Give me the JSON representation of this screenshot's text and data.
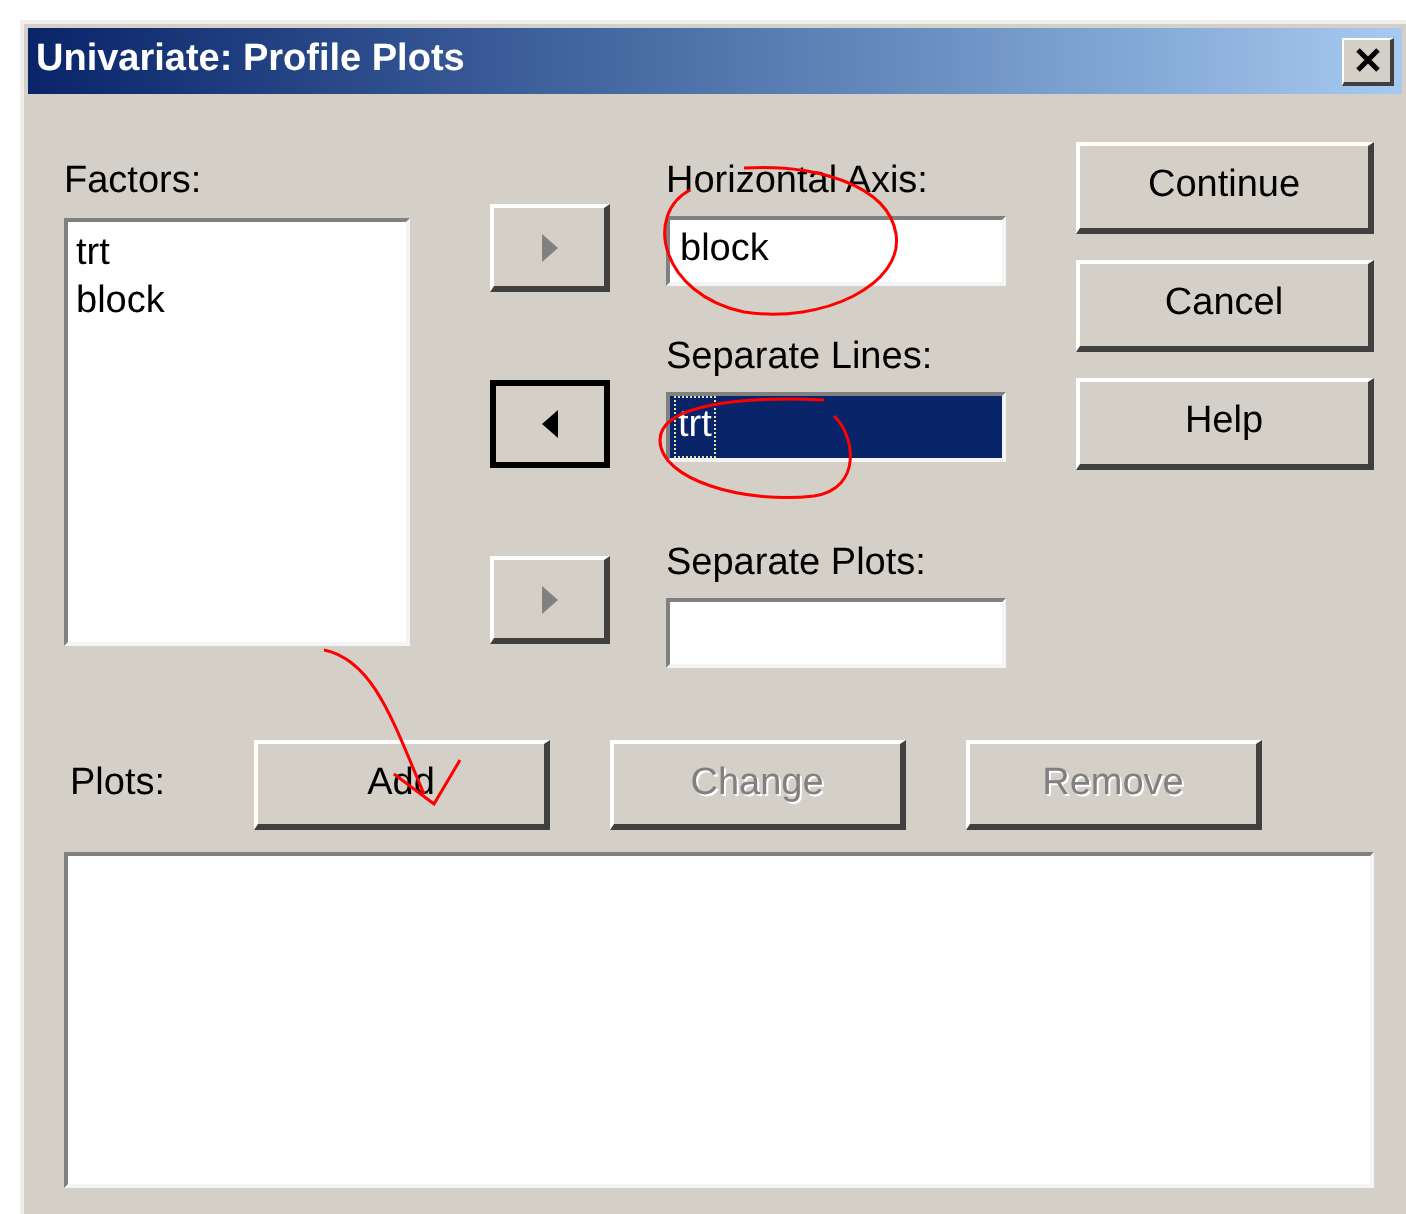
{
  "window": {
    "title": "Univariate: Profile Plots"
  },
  "factors": {
    "label": "Factors:",
    "items": [
      "trt",
      "block"
    ]
  },
  "move_buttons": [
    {
      "kind": "right",
      "default": false
    },
    {
      "kind": "left",
      "default": true
    },
    {
      "kind": "right",
      "default": false
    }
  ],
  "targets": [
    {
      "label": "Horizontal Axis:",
      "value": "block",
      "selected": false
    },
    {
      "label": "Separate Lines:",
      "value": "trt",
      "selected": true
    },
    {
      "label": "Separate Plots:",
      "selected": false
    }
  ],
  "side_buttons": [
    "Continue",
    "Cancel",
    "Help"
  ],
  "plots": {
    "label": "Plots:",
    "buttons": [
      {
        "label": "Add",
        "disabled": false
      },
      {
        "label": "Change",
        "disabled": true
      },
      {
        "label": "Remove",
        "disabled": true
      }
    ]
  }
}
